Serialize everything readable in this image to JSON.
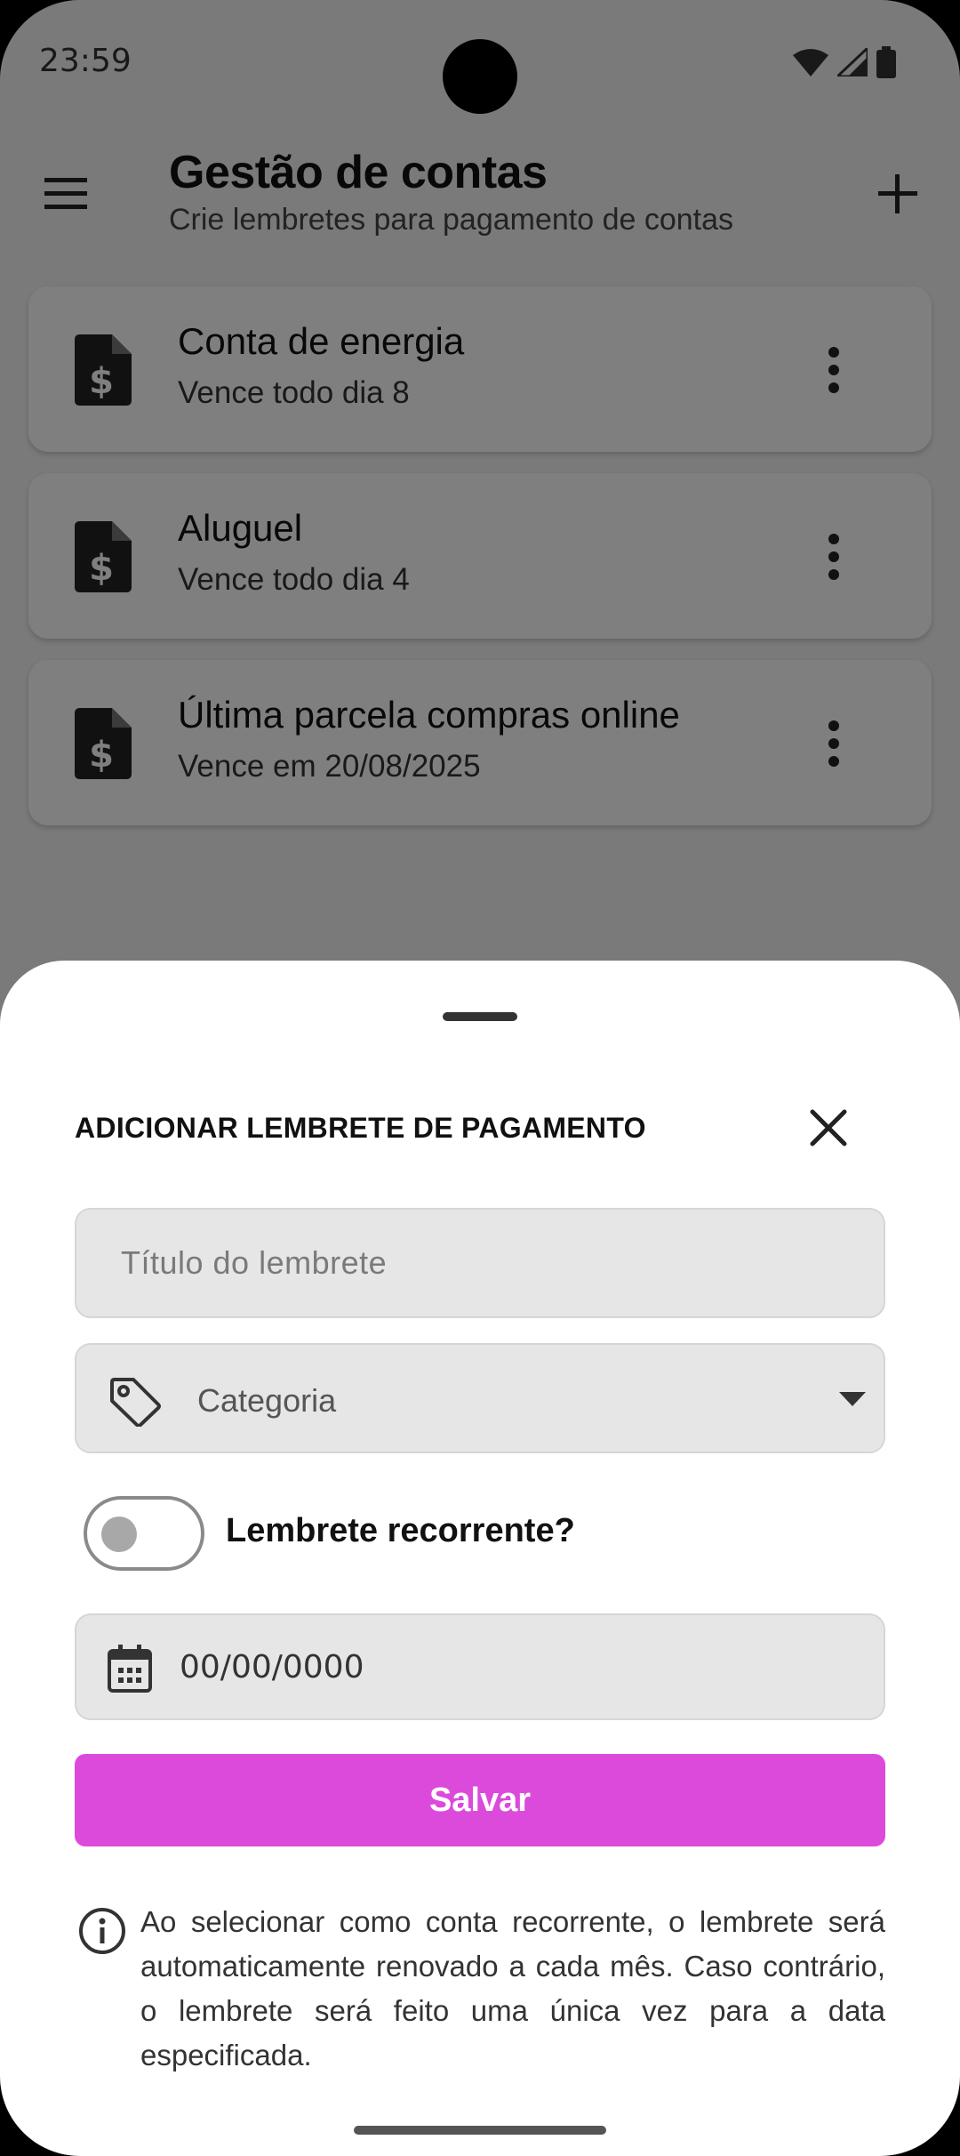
{
  "status_bar": {
    "time": "23:59"
  },
  "app_bar": {
    "title": "Gestão de contas",
    "subtitle": "Crie lembretes para pagamento de contas"
  },
  "bills": [
    {
      "title": "Conta de energia",
      "due": "Vence todo dia 8"
    },
    {
      "title": "Aluguel",
      "due": "Vence todo dia 4"
    },
    {
      "title": "Última parcela compras online",
      "due": "Vence em 20/08/2025"
    }
  ],
  "sheet": {
    "title": "ADICIONAR LEMBRETE DE PAGAMENTO",
    "title_placeholder": "Título do lembrete",
    "category_label": "Categoria",
    "recurring_label": "Lembrete recorrente?",
    "recurring_on": false,
    "date_value": "00/00/0000",
    "save_label": "Salvar",
    "info_text": "Ao selecionar como conta recorrente, o lembrete será automaticamente renovado a cada mês. Caso contrário, o lembrete será feito uma única vez para a data especificada."
  },
  "colors": {
    "accent": "#dc4adc",
    "field_bg": "#e6e6e6",
    "scrim": "rgba(0,0,0,0.5)"
  },
  "icons": {
    "menu": "menu-icon",
    "add": "plus-icon",
    "bill": "invoice-dollar-icon",
    "more": "more-vertical-icon",
    "close": "close-icon",
    "category": "tag-icon",
    "dropdown": "caret-down-icon",
    "date": "calendar-icon",
    "info": "info-icon"
  }
}
